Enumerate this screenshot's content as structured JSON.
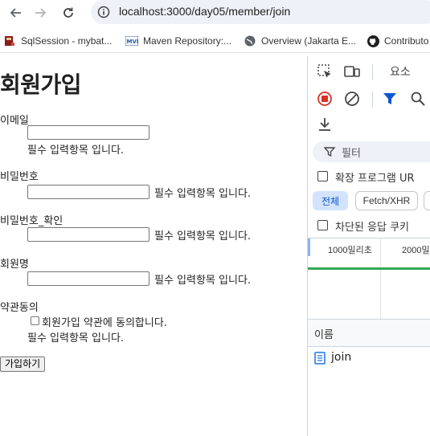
{
  "browser": {
    "url": "localhost:3000/day05/member/join",
    "bookmarks": [
      {
        "label": "SqlSession - mybat...",
        "icon": "book-icon"
      },
      {
        "label": "Maven Repository:...",
        "icon": "maven-icon"
      },
      {
        "label": "Overview (Jakarta E...",
        "icon": "globe-icon"
      },
      {
        "label": "Contributo",
        "icon": "github-icon"
      }
    ]
  },
  "form": {
    "title": "회원가입",
    "email_label": "이메일",
    "email_hint": "필수 입력항목 입니다.",
    "password_label": "비밀번호",
    "password_hint": "필수 입력항목 입니다.",
    "password_confirm_label": "비밀번호_확인",
    "password_confirm_hint": "필수 입력항목 입니다.",
    "name_label": "회원명",
    "name_hint": "필수 입력항목 입니다.",
    "agree_label": "약관동의",
    "agree_checkbox_label": "회원가입 약관에 동의합니다.",
    "agree_hint": "필수 입력항목 입니다.",
    "submit_label": "가입하기"
  },
  "devtools": {
    "elements_tab": "요소",
    "filter_placeholder": "필터",
    "hide_extension_label": "확장 프로그램 UR",
    "chip_all": "전체",
    "chip_fetch": "Fetch/XHR",
    "blocked_label": "차단된 응답 쿠키",
    "tick_1000": "1000밀리초",
    "tick_2000": "2000밀",
    "name_column": "이름",
    "request_name": "join",
    "accent_color": "#0b57d0",
    "record_color": "#d93025"
  }
}
